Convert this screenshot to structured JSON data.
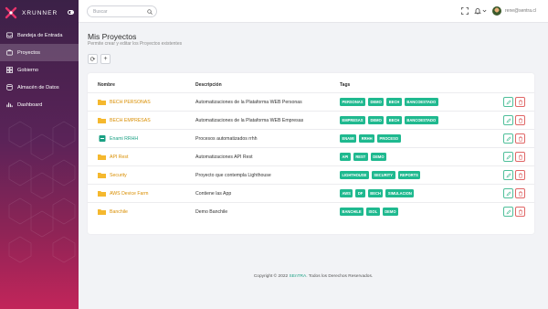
{
  "app": {
    "name": "XRUNNER"
  },
  "sidebar": {
    "items": [
      {
        "label": "Bandeja de Entrada",
        "icon": "inbox-icon",
        "active": false
      },
      {
        "label": "Proyectos",
        "icon": "briefcase-icon",
        "active": true
      },
      {
        "label": "Gobierno",
        "icon": "grid-icon",
        "active": false
      },
      {
        "label": "Almacén de Datos",
        "icon": "database-icon",
        "active": false
      },
      {
        "label": "Dashboard",
        "icon": "bar-chart-icon",
        "active": false
      }
    ]
  },
  "topbar": {
    "search_placeholder": "Buscar",
    "user_email": "rene@sentra.cl",
    "icons": [
      "expand-icon",
      "bell-icon",
      "chevron-down-icon",
      "avatar"
    ]
  },
  "page": {
    "title": "Mis Proyectos",
    "subtitle": "Permite crear y editar los Proyectos existentes",
    "refresh_label": "⟳",
    "add_label": "+"
  },
  "table": {
    "headers": {
      "name": "Nombre",
      "description": "Descripción",
      "tags": "Tags"
    },
    "rows": [
      {
        "name": "BECH PERSONAS",
        "icon": "folder-icon",
        "description": "Automatizaciones de la Plataforma WEB Personas",
        "tags": [
          "PERSONAS",
          "DEMO",
          "BECH",
          "BANCOESTADO"
        ]
      },
      {
        "name": "BECH EMPRESAS",
        "icon": "folder-icon",
        "description": "Automatizaciones de la Plataforma WEB Empresas",
        "tags": [
          "EMPRESAS",
          "DEMO",
          "BECH",
          "BANCOESTADO"
        ]
      },
      {
        "name": "Enami RRHH",
        "icon": "minus-square-icon",
        "description": "Procesos automatizados rrhh",
        "tags": [
          "ENAMI",
          "RRHH",
          "PROCESO"
        ]
      },
      {
        "name": "API Rest",
        "icon": "folder-icon",
        "description": "Automatizaciones API Rest",
        "tags": [
          "API",
          "REST",
          "DEMO"
        ]
      },
      {
        "name": "Security",
        "icon": "folder-icon",
        "description": "Proyecto que contempla Lighthouse",
        "tags": [
          "LIGHTHOUSE",
          "SECURITY",
          "REPORTS"
        ]
      },
      {
        "name": "AWS Device Farm",
        "icon": "folder-icon",
        "description": "Contiene las App",
        "tags": [
          "AWS",
          "DF",
          "BECH",
          "SIMULACION"
        ]
      },
      {
        "name": "Banchile",
        "icon": "folder-icon",
        "description": "Demo Banchile",
        "tags": [
          "BANCHILE",
          "ISOL",
          "DEMO"
        ]
      }
    ]
  },
  "footer": {
    "prefix": "Copyright © 2022 ",
    "brand": "SEnTRA",
    "suffix": ". Todos los Derechos Reservados."
  },
  "colors": {
    "accent": "#1fb98f",
    "folder": "#f5b82e",
    "danger": "#e06666",
    "sidebar_top": "#3b2147",
    "sidebar_bottom": "#c2255a"
  }
}
